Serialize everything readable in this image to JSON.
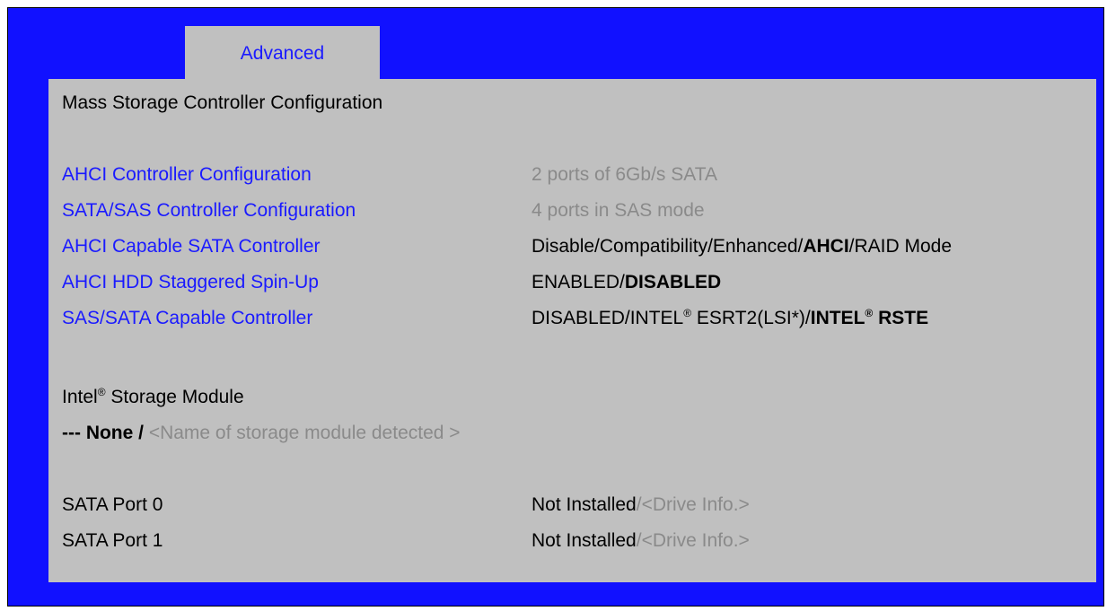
{
  "tab": {
    "label": "Advanced"
  },
  "page": {
    "title": "Mass Storage Controller Configuration"
  },
  "settings": [
    {
      "label": "AHCI Controller Configuration",
      "value": "2 ports of 6Gb/s SATA"
    },
    {
      "label": "SATA/SAS Controller Configuration",
      "value": "4 ports in SAS mode"
    },
    {
      "label": "AHCI Capable SATA Controller",
      "options": [
        "Disable/Compatibility/Enhanced/",
        "AHCI",
        "/RAID Mode"
      ]
    },
    {
      "label": "AHCI HDD Staggered Spin-Up",
      "options": [
        "ENABLED/",
        "DISABLED"
      ]
    },
    {
      "label": "SAS/SATA Capable Controller",
      "options": [
        "DISABLED/INTEL",
        "®",
        " ESRT2(LSI*)/",
        "INTEL",
        "®",
        " RSTE"
      ]
    }
  ],
  "storage_module": {
    "heading": "Intel",
    "heading_mark": "®",
    "heading_rest": " Storage Module",
    "value_bold": "--- None /",
    "value_hint": " <Name of storage module detected >"
  },
  "ports": [
    {
      "label": "SATA Port 0",
      "status": "Not Installed",
      "hint": "/<Drive Info.>"
    },
    {
      "label": "SATA Port 1",
      "status": "Not Installed",
      "hint": "/<Drive Info.>"
    }
  ],
  "colors": {
    "background_blue": "#1111ff",
    "panel_gray": "#c0c0c0",
    "link_blue": "#1a1aff",
    "hint_gray": "#8a8a8a"
  }
}
